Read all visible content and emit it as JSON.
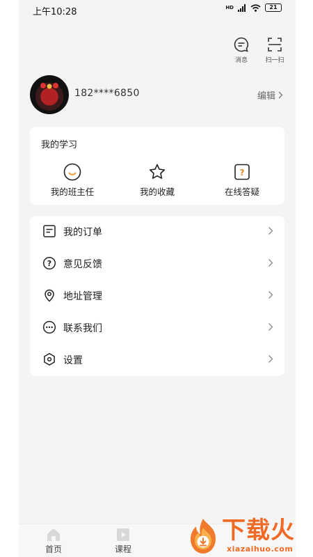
{
  "status_bar": {
    "time": "上午10:28",
    "network": "HD",
    "battery": "21"
  },
  "top_actions": {
    "messages_label": "消息",
    "scan_label": "扫一扫"
  },
  "profile": {
    "phone": "182****6850",
    "edit_label": "编辑"
  },
  "learning": {
    "title": "我的学习",
    "items": [
      {
        "label": "我的班主任",
        "icon": "smile-face-icon"
      },
      {
        "label": "我的收藏",
        "icon": "star-icon"
      },
      {
        "label": "在线答疑",
        "icon": "question-square-icon"
      }
    ]
  },
  "menu": {
    "items": [
      {
        "label": "我的订单",
        "icon": "order-list-icon"
      },
      {
        "label": "意见反馈",
        "icon": "question-circle-icon"
      },
      {
        "label": "地址管理",
        "icon": "location-pin-icon"
      },
      {
        "label": "联系我们",
        "icon": "chat-dots-icon"
      },
      {
        "label": "设置",
        "icon": "settings-hexagon-icon"
      }
    ]
  },
  "tabbar": {
    "items": [
      {
        "label": "首页"
      },
      {
        "label": "课程"
      }
    ]
  },
  "watermark": {
    "title": "下载火",
    "url": "xiazaihuo.com"
  },
  "colors": {
    "accent": "#ef6a24",
    "background": "#f4f4f4",
    "card": "#ffffff",
    "smile": "#e8a13a",
    "question": "#e08a2a"
  }
}
